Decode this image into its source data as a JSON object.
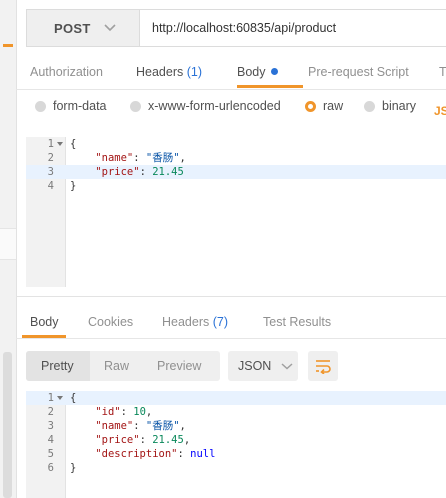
{
  "request": {
    "method": "POST",
    "url": "http://localhost:60835/api/product"
  },
  "request_tabs": [
    {
      "label": "Authorization"
    },
    {
      "label": "Headers",
      "count": "(1)"
    },
    {
      "label": "Body",
      "active": true
    },
    {
      "label": "Pre-request Script"
    },
    {
      "label": "T"
    }
  ],
  "body_types": [
    {
      "label": "form-data",
      "selected": false
    },
    {
      "label": "x-www-form-urlencoded",
      "selected": false
    },
    {
      "label": "raw",
      "selected": true
    },
    {
      "label": "binary",
      "selected": false
    }
  ],
  "body_format_partial": "JS",
  "request_body_lines": [
    {
      "num": "1",
      "text": "{"
    },
    {
      "num": "2",
      "text": "    \"name\": \"香肠\","
    },
    {
      "num": "3",
      "text": "    \"price\": 21.45"
    },
    {
      "num": "4",
      "text": "}"
    }
  ],
  "response_tabs": [
    {
      "label": "Body",
      "active": true
    },
    {
      "label": "Cookies"
    },
    {
      "label": "Headers",
      "count": "(7)"
    },
    {
      "label": "Test Results"
    }
  ],
  "response_view_modes": [
    "Pretty",
    "Raw",
    "Preview"
  ],
  "response_format": "JSON",
  "response_body_lines": [
    {
      "num": "1",
      "text": "{"
    },
    {
      "num": "2",
      "text": "    \"id\": 10,"
    },
    {
      "num": "3",
      "text": "    \"name\": \"香肠\","
    },
    {
      "num": "4",
      "text": "    \"price\": 21.45,"
    },
    {
      "num": "5",
      "text": "    \"description\": null"
    },
    {
      "num": "6",
      "text": "}"
    }
  ],
  "colors": {
    "accent": "#f0952b",
    "count_blue": "#2a72d6",
    "highlight": "#e8f2fe"
  }
}
